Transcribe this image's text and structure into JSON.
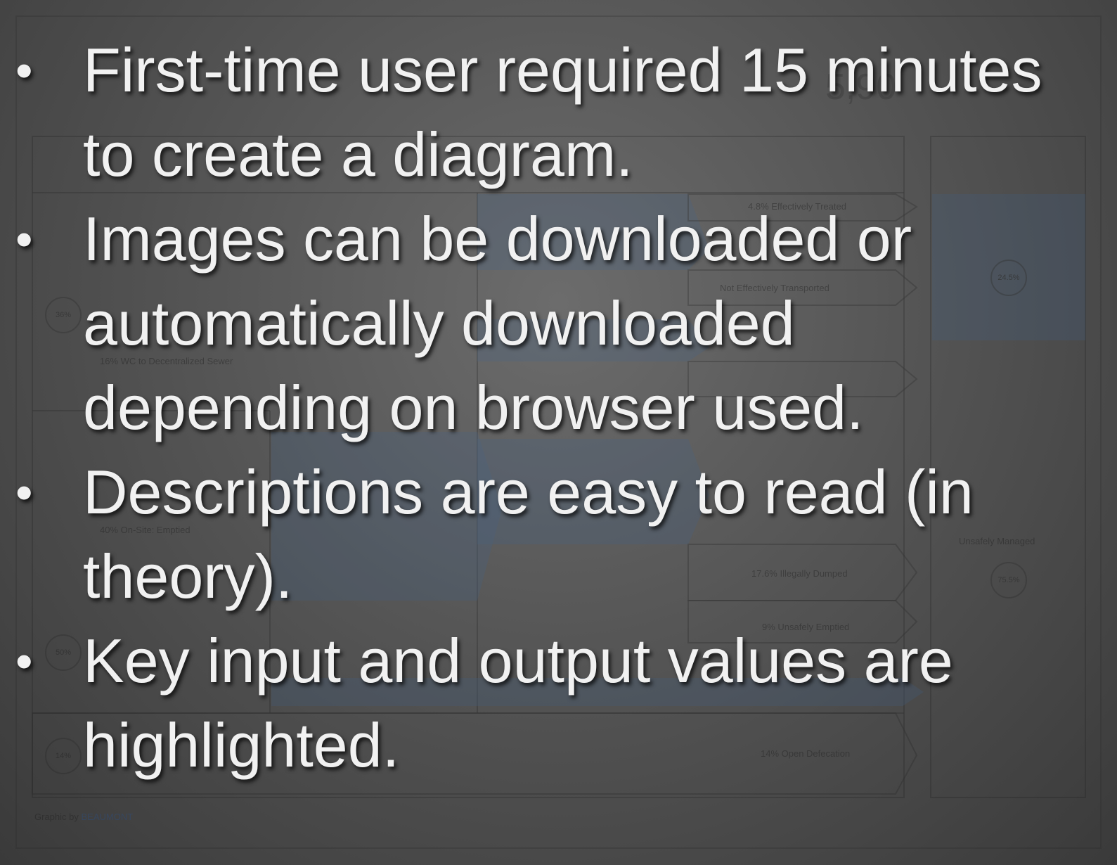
{
  "slide": {
    "bullets": [
      {
        "text": "First-time user required 15 minutes to create a diagram."
      },
      {
        "text": "Images can be downloaded or automatically downloaded depending on browser used."
      },
      {
        "text": "Descriptions are easy to read (in theory)."
      },
      {
        "text": "Key input and output values are highlighted."
      }
    ],
    "bullet_glyph": "•"
  },
  "background_diagram": {
    "title_fragment": "5,90",
    "labels": [
      "4.8% Effectively Treated",
      "Not Effectively Transported",
      "16% WC to Decentralized Sewer",
      "40% On-Site: Emptied",
      "17.6% Illegally Dumped",
      "9% Unsafely Emptied",
      "14% Open Defecation",
      "Unsafely Managed"
    ],
    "circles": [
      "36%",
      "50%",
      "14%",
      "24.5%",
      "75.5%"
    ],
    "credit_prefix": "Graphic by",
    "credit_link": "BEAUMONT",
    "colors": {
      "accent_blue": "#4a6a8a"
    }
  }
}
